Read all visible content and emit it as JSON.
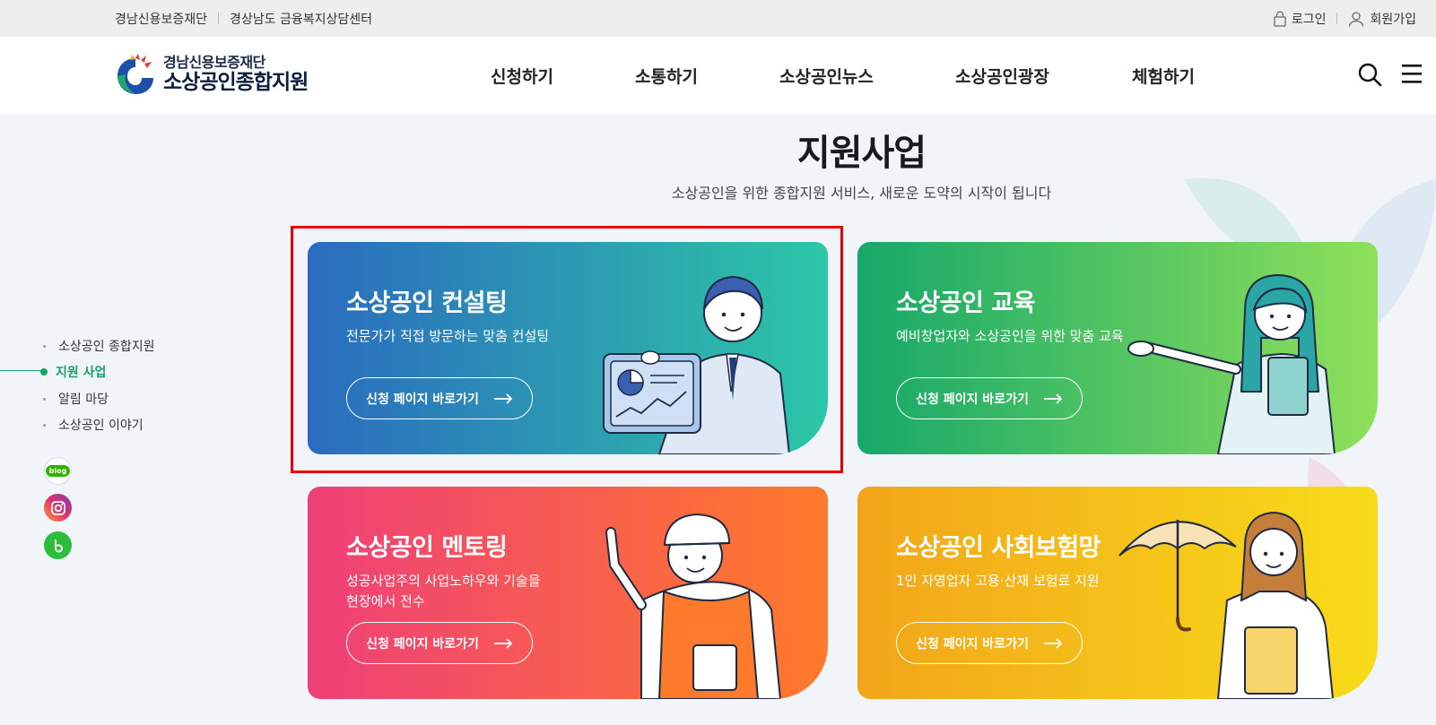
{
  "util": {
    "left_links": [
      "경남신용보증재단",
      "경상남도 금융복지상담센터"
    ],
    "login": "로그인",
    "signup": "회원가입"
  },
  "header": {
    "logo_sub": "경남신용보증재단",
    "logo_main": "소상공인종합지원",
    "nav": [
      "신청하기",
      "소통하기",
      "소상공인뉴스",
      "소상공인광장",
      "체험하기"
    ]
  },
  "section": {
    "title": "지원사업",
    "subtitle": "소상공인을 위한 종합지원 서비스, 새로운 도약의 시작이 됩니다"
  },
  "sidenav": {
    "items": [
      "소상공인 종합지원",
      "지원 사업",
      "알림 마당",
      "소상공인 이야기"
    ],
    "active_index": 1,
    "social_blog_label": "blog"
  },
  "cards": [
    {
      "title": "소상공인 컨설팅",
      "desc": "전문가가 직접 방문하는 맞춤 컨설팅",
      "button": "신청 페이지 바로가기",
      "gradient": [
        "#2b6bbf",
        "#2cc7a6"
      ]
    },
    {
      "title": "소상공인 교육",
      "desc": "예비창업자와 소상공인을 위한 맞춤 교육",
      "button": "신청 페이지 바로가기",
      "gradient": [
        "#16a86a",
        "#8fe05a"
      ]
    },
    {
      "title": "소상공인 멘토링",
      "desc": "성공사업주의 사업노하우와 기술을\n현장에서 전수",
      "button": "신청 페이지 바로가기",
      "gradient": [
        "#ef3f78",
        "#ff7a2a"
      ]
    },
    {
      "title": "소상공인 사회보험망",
      "desc": "1인 자영업자 고용·산재 보험료 지원",
      "button": "신청 페이지 바로가기",
      "gradient": [
        "#f2a51a",
        "#f8dc1a"
      ]
    }
  ],
  "colors": {
    "accent_green": "#19a06a",
    "highlight_red": "#ee0000"
  }
}
